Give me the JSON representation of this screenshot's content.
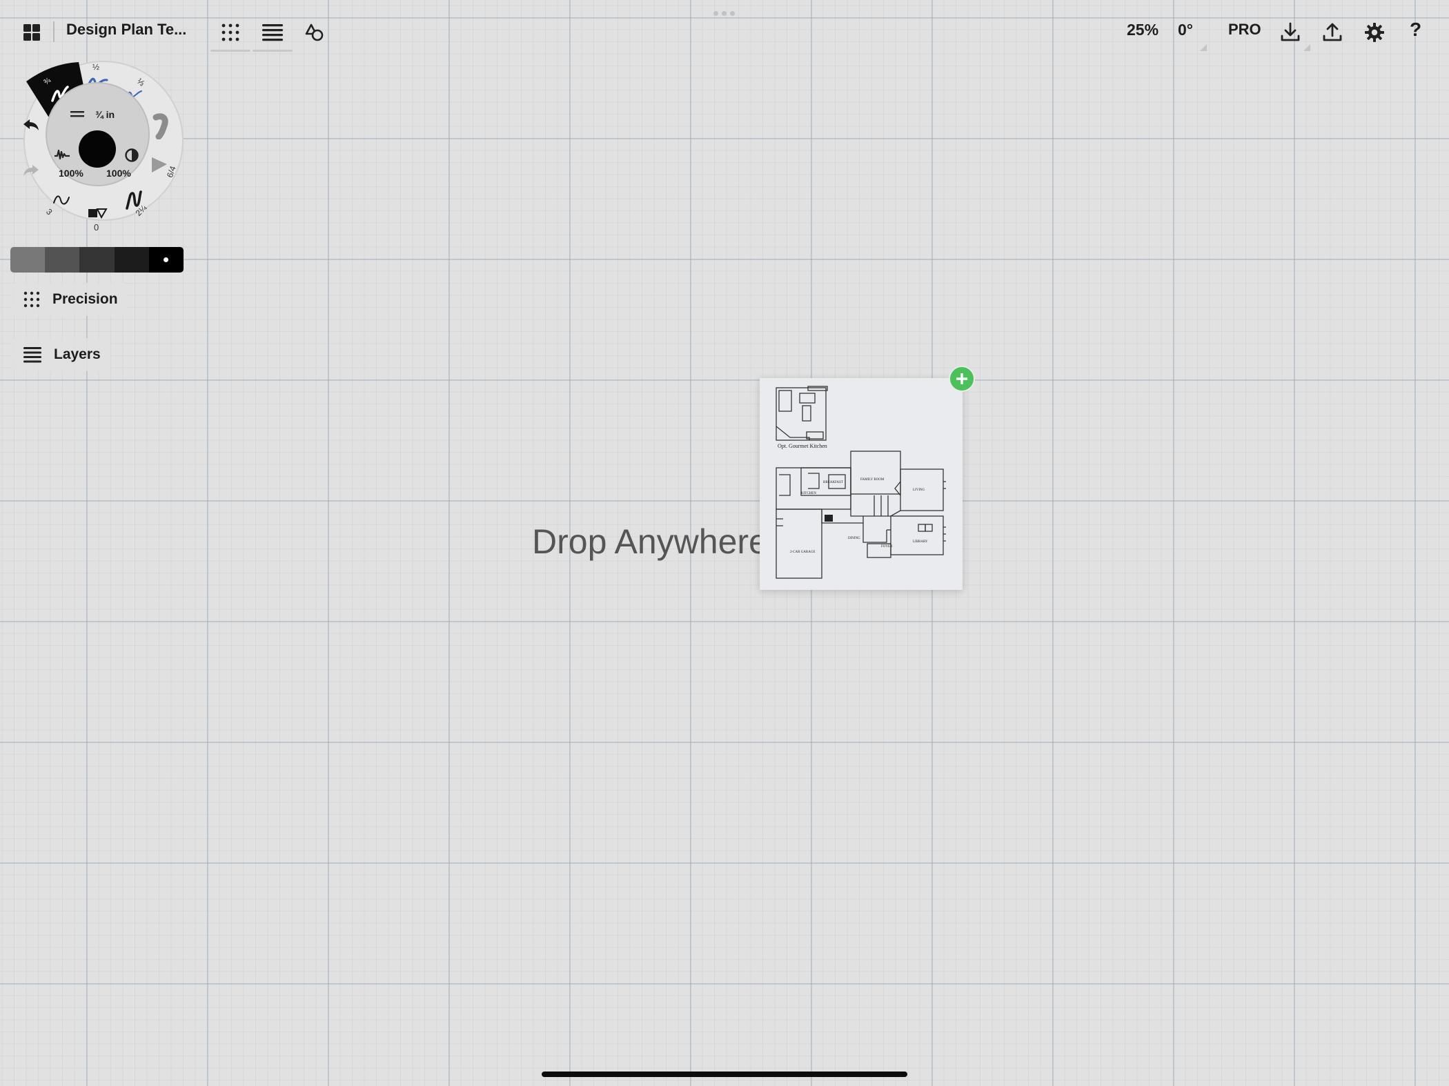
{
  "topbar": {
    "gallery_icon": "grid-2x2-icon",
    "title": "Design Plan Te...",
    "precision_tool_icon": "precision-grid-icon",
    "layers_tool_icon": "layers-icon",
    "shapes_tool_icon": "shapes-icon",
    "zoom": "25%",
    "rotation": "0°",
    "pro_label": "PRO",
    "import_icon": "download-icon",
    "export_icon": "share-icon",
    "settings_icon": "gear-icon",
    "help_label": "?"
  },
  "brush_wheel": {
    "size_label": "¾ in",
    "smoothing": "100%",
    "opacity": "100%",
    "pressure_value": "0",
    "presets": [
      "¾",
      "½",
      "⅓",
      "6/4",
      "2¼",
      "3"
    ],
    "undo_icon": "undo-icon",
    "redo_icon": "redo-icon"
  },
  "swatches": [
    "#777777",
    "#505050",
    "#333333",
    "#1a1a1a",
    "#000000"
  ],
  "side_panel": {
    "precision_label": "Precision",
    "layers_label": "Layers"
  },
  "canvas": {
    "drop_text": "Drop Anywhere to Import",
    "plan_caption": "Opt. Gourmet Kitchen",
    "plan_rooms": {
      "breakfast": "BREAKFAST",
      "family_room": "FAMILY ROOM",
      "kitchen": "KITCHEN",
      "living": "LIVING",
      "dining": "DINING",
      "foyer": "FOYER",
      "library": "LIBRARY",
      "garage": "2-CAR GARAGE"
    },
    "add_icon": "plus-icon",
    "accent": "#4cc05a"
  }
}
